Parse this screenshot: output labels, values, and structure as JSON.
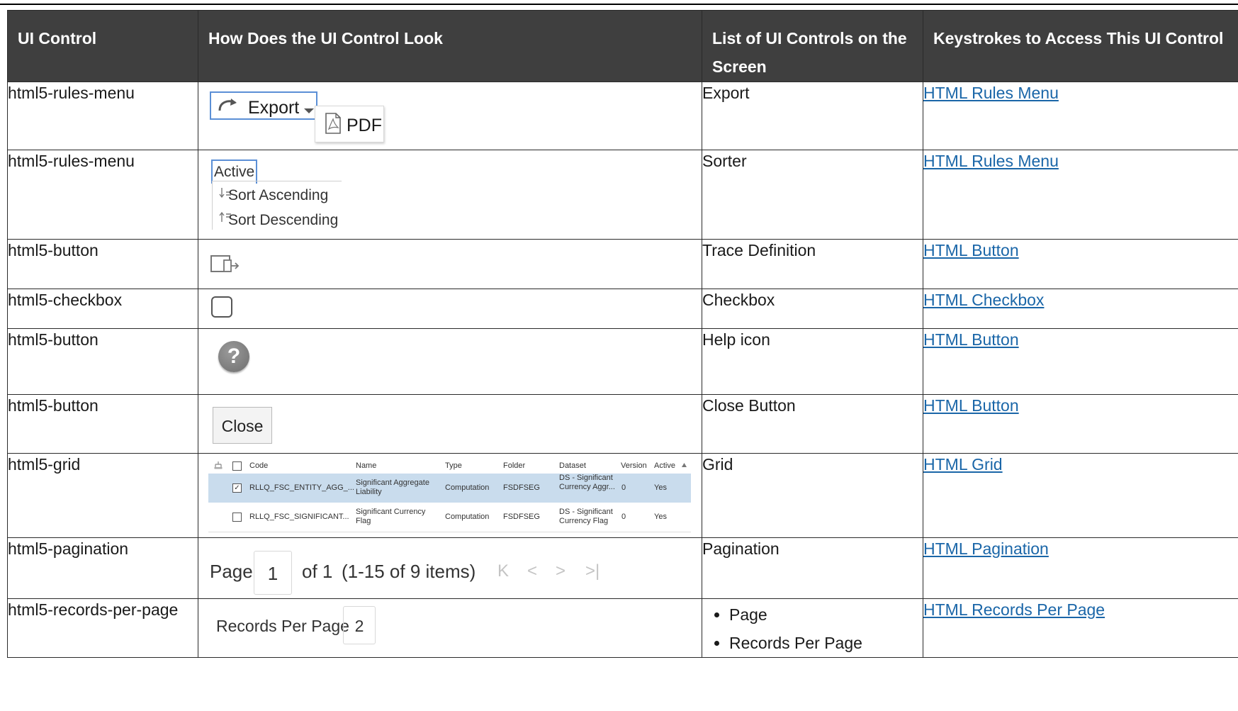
{
  "table": {
    "headers": [
      "UI Control",
      "How Does the UI Control Look",
      "List of UI Controls on the Screen",
      "Keystrokes to Access This UI Control"
    ],
    "rows": [
      {
        "control": "html5-rules-menu",
        "list": "Export",
        "link": "HTML Rules Menu"
      },
      {
        "control": "html5-rules-menu",
        "list": "Sorter",
        "link": "HTML Rules Menu"
      },
      {
        "control": "html5-button",
        "list": "Trace Definition",
        "link": "HTML Button"
      },
      {
        "control": "html5-checkbox",
        "list": "Checkbox",
        "link": "HTML Checkbox"
      },
      {
        "control": "html5-button",
        "list": "Help icon",
        "link": "HTML Button"
      },
      {
        "control": "html5-button",
        "list": "Close Button",
        "link": "HTML Button"
      },
      {
        "control": "html5-grid",
        "list": "Grid",
        "link": "HTML Grid"
      },
      {
        "control": "html5-pagination",
        "list": "Pagination",
        "link": "HTML Pagination"
      },
      {
        "control": "html5-records-per-page",
        "list_items": [
          "Page",
          "Records Per Page"
        ],
        "link": "HTML Records Per Page"
      }
    ]
  },
  "visuals": {
    "export": {
      "button": "Export",
      "menu_item": "PDF"
    },
    "sorter": {
      "field": "Active",
      "items": [
        "Sort Ascending",
        "Sort Descending"
      ]
    },
    "help_glyph": "?",
    "close": "Close",
    "grid": {
      "columns": [
        "Code",
        "Name",
        "Type",
        "Folder",
        "Dataset",
        "Version",
        "Active"
      ],
      "rows": [
        {
          "code": "RLLQ_FSC_ENTITY_AGG_...",
          "name": "Significant Aggregate Liability",
          "type": "Computation",
          "folder": "FSDFSEG",
          "dataset": "DS - Significant Currency Aggr...",
          "version": "0",
          "active": "Yes",
          "checked": true
        },
        {
          "code": "RLLQ_FSC_SIGNIFICANT...",
          "name": "Significant Currency Flag",
          "type": "Computation",
          "folder": "FSDFSEG",
          "dataset": "DS - Significant Currency Flag",
          "version": "0",
          "active": "Yes",
          "checked": false
        }
      ]
    },
    "pagination": {
      "page_label": "Page",
      "page_value": "1",
      "of_text": "of 1",
      "range_text": "(1-15 of  9 items)"
    },
    "records_per_page": {
      "label": "Records Per Page",
      "value": "2"
    }
  },
  "colors": {
    "header_bg": "#3f3f3f",
    "link": "#1a66a8",
    "focus_border": "#5b8fd6",
    "grid_selected": "#c9dced"
  },
  "icons": [
    "redo-arrow-icon",
    "pdf-icon",
    "sort-ascending-icon",
    "sort-descending-icon",
    "trace-definition-icon",
    "help-icon",
    "first-page-icon",
    "previous-page-icon",
    "next-page-icon",
    "last-page-icon",
    "sort-arrow-icon"
  ]
}
